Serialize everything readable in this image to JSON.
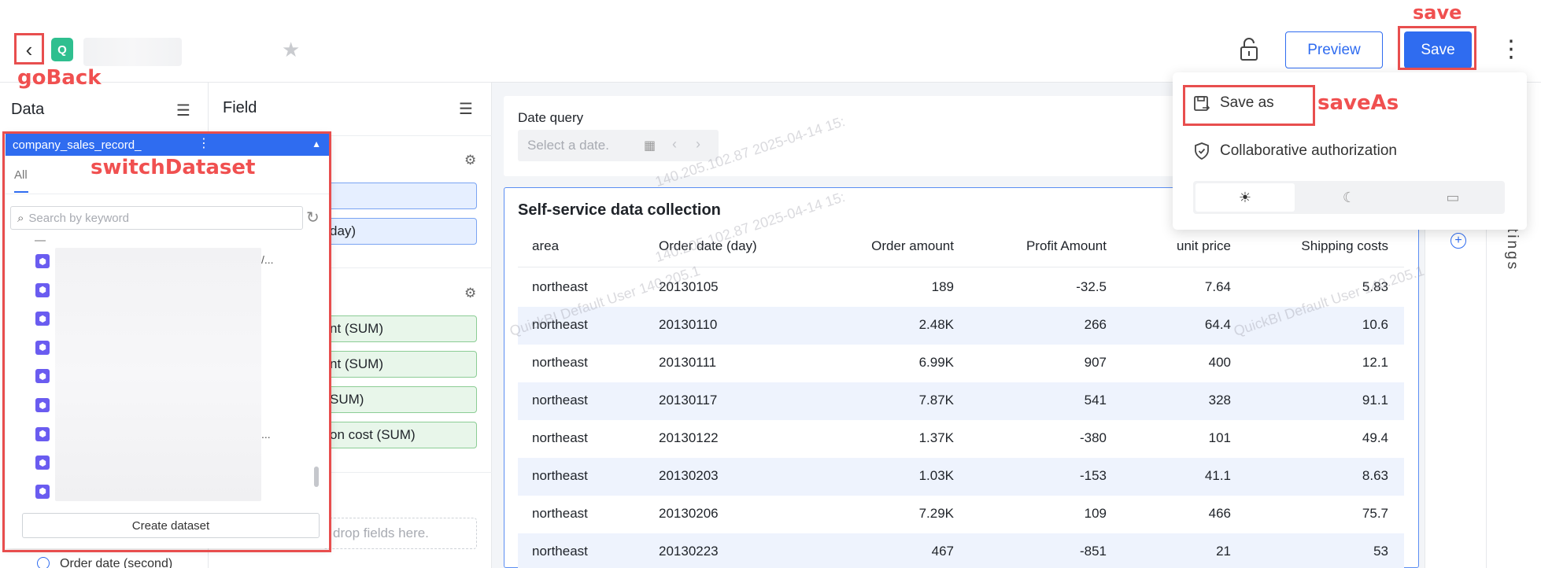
{
  "header": {
    "back_glyph": "‹",
    "app_icon_glyph": "Q",
    "preview_label": "Preview",
    "save_label": "Save",
    "more_glyph": "⋮"
  },
  "annotations": {
    "go_back": "goBack",
    "save": "save",
    "save_as": "saveAs",
    "switch_dataset": "switchDataset"
  },
  "data_panel": {
    "title": "Data",
    "dataset_name": "company_sales_record_",
    "tab_all": "All",
    "search_placeholder": "Search by keyword",
    "create_button": "Create dataset",
    "partial_ellipsis_1": "/...",
    "partial_ellipsis_2": "...",
    "bottom_field": "Order date (second)"
  },
  "field_panel": {
    "title": "Field",
    "chips_blue": [
      "",
      "day)"
    ],
    "chips_green": [
      "nt (SUM)",
      "nt (SUM)",
      "SUM)",
      "on cost (SUM)"
    ],
    "drop_hint": "drop fields here."
  },
  "query": {
    "label": "Date query",
    "placeholder": "Select a date."
  },
  "table": {
    "title": "Self-service data collection",
    "columns": [
      "area",
      "Order date (day)",
      "Order amount",
      "Profit Amount",
      "unit price",
      "Shipping costs"
    ],
    "rows": [
      [
        "northeast",
        "20130105",
        "189",
        "-32.5",
        "7.64",
        "5.83"
      ],
      [
        "northeast",
        "20130110",
        "2.48K",
        "266",
        "64.4",
        "10.6"
      ],
      [
        "northeast",
        "20130111",
        "6.99K",
        "907",
        "400",
        "12.1"
      ],
      [
        "northeast",
        "20130117",
        "7.87K",
        "541",
        "328",
        "91.1"
      ],
      [
        "northeast",
        "20130122",
        "1.37K",
        "-380",
        "101",
        "49.4"
      ],
      [
        "northeast",
        "20130203",
        "1.03K",
        "-153",
        "41.1",
        "8.63"
      ],
      [
        "northeast",
        "20130206",
        "7.29K",
        "109",
        "466",
        "75.7"
      ],
      [
        "northeast",
        "20130223",
        "467",
        "-851",
        "21",
        "53"
      ]
    ]
  },
  "watermark": {
    "text_a": "140.205.102.87 2025-04-14 15:",
    "text_b": "QuickBI Default User 140.205.1"
  },
  "save_menu": {
    "save_as": "Save as",
    "collab": "Collaborative authorization",
    "theme_light": "☀",
    "theme_dark": "☾",
    "theme_screen": "▭"
  },
  "right_panel": {
    "vertical_label": "tings"
  },
  "colors": {
    "accent": "#2f6cf0",
    "annotation_red": "#e84e4e",
    "row_alt": "#eef3fd"
  }
}
